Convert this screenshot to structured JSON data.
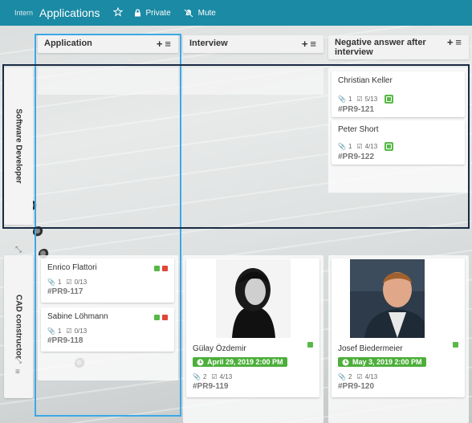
{
  "topbar": {
    "crumb": "Intern",
    "title": "Applications",
    "private_label": "Private",
    "mute_label": "Mute",
    "bg_color": "#1b8aa4"
  },
  "columns": [
    {
      "label": "Application"
    },
    {
      "label": "Interview"
    },
    {
      "label": "Negative answer after interview"
    }
  ],
  "lanes": [
    {
      "label": "Software Developer"
    },
    {
      "label": "CAD constructor"
    }
  ],
  "cards": {
    "christian": {
      "name": "Christian Keller",
      "attachments": "1",
      "checklist": "5/13",
      "code": "#PR9-121"
    },
    "peter": {
      "name": "Peter Short",
      "attachments": "1",
      "checklist": "4/13",
      "code": "#PR9-122"
    },
    "enrico": {
      "name": "Enrico Flattori",
      "attachments": "1",
      "checklist": "0/13",
      "code": "#PR9-117"
    },
    "sabine": {
      "name": "Sabine Löhmann",
      "attachments": "1",
      "checklist": "0/13",
      "code": "#PR9-118"
    },
    "guelay": {
      "name": "Gülay Özdemir",
      "date": "April 29, 2019 2:00 PM",
      "attachments": "2",
      "checklist": "4/13",
      "code": "#PR9-119"
    },
    "josef": {
      "name": "Josef Biedermeier",
      "date": "May 3, 2019 2:00 PM",
      "attachments": "2",
      "checklist": "4/13",
      "code": "#PR9-120"
    }
  },
  "colors": {
    "label_green": "#58b947",
    "label_red": "#e0463a",
    "date_green": "#4caf3a",
    "highlight_blue": "#3aa9e6",
    "highlight_navy": "#1a2a45"
  }
}
